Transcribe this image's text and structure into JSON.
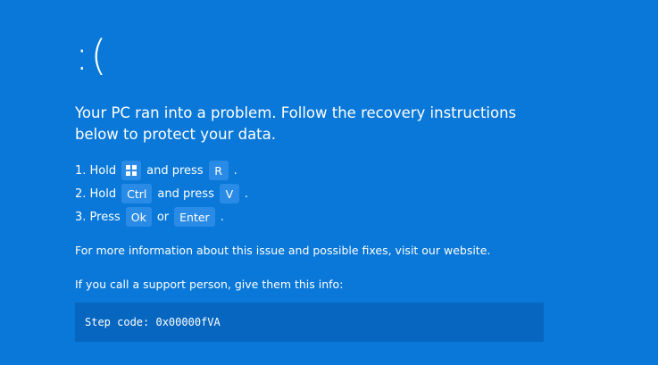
{
  "frown": ":(",
  "headline": "Your PC ran into a problem. Follow the recovery instructions below to protect your data.",
  "steps": [
    {
      "prefix": "1. Hold",
      "key1": "windows",
      "mid": "and press",
      "key2": "R",
      "suffix": "."
    },
    {
      "prefix": "2. Hold",
      "key1": "Ctrl",
      "mid": "and press",
      "key2": "V",
      "suffix": "."
    },
    {
      "prefix": "3. Press",
      "key1": "Ok",
      "mid": "or",
      "key2": "Enter",
      "suffix": "."
    }
  ],
  "info_line": "For more information about this issue and possible fixes, visit our website.",
  "support_line": "If you call a support person, give them this info:",
  "step_code": "Step code: 0x00000fVA",
  "colors": {
    "background": "#0a78d8",
    "key_background": "#2a8be6",
    "code_box": "#0766c0",
    "text": "#ffffff"
  },
  "icons": {
    "windows_key": "windows-logo-icon"
  }
}
